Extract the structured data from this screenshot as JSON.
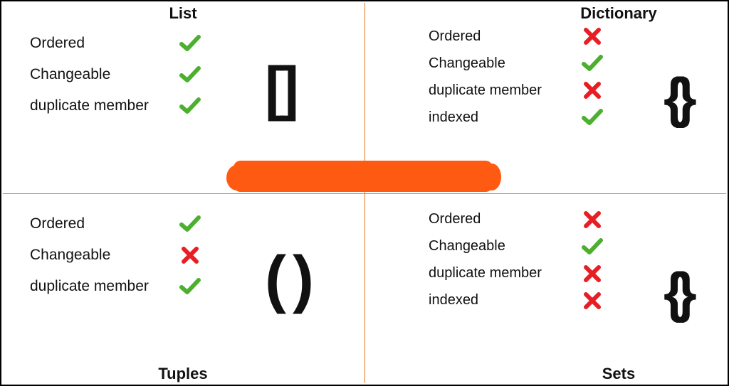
{
  "colors": {
    "check": "#4caf2f",
    "cross": "#e81e25",
    "divider": "#e07a2a",
    "blob": "#ff5a12"
  },
  "quadrants": {
    "list": {
      "title": "List",
      "glyph": "[]",
      "rows": [
        {
          "label": "Ordered",
          "value": true
        },
        {
          "label": "Changeable",
          "value": true
        },
        {
          "label": "duplicate member",
          "value": true
        }
      ]
    },
    "dictionary": {
      "title": "Dictionary",
      "glyph": "{}",
      "rows": [
        {
          "label": "Ordered",
          "value": false
        },
        {
          "label": "Changeable",
          "value": true
        },
        {
          "label": "duplicate member",
          "value": false
        },
        {
          "label": "indexed",
          "value": true
        }
      ]
    },
    "tuples": {
      "title": "Tuples",
      "glyph": "( )",
      "rows": [
        {
          "label": "Ordered",
          "value": true
        },
        {
          "label": "Changeable",
          "value": false
        },
        {
          "label": "duplicate member",
          "value": true
        }
      ]
    },
    "sets": {
      "title": "Sets",
      "glyph": "{}",
      "rows": [
        {
          "label": "Ordered",
          "value": false
        },
        {
          "label": "Changeable",
          "value": true
        },
        {
          "label": "duplicate member",
          "value": false
        },
        {
          "label": "indexed",
          "value": false
        }
      ]
    }
  }
}
